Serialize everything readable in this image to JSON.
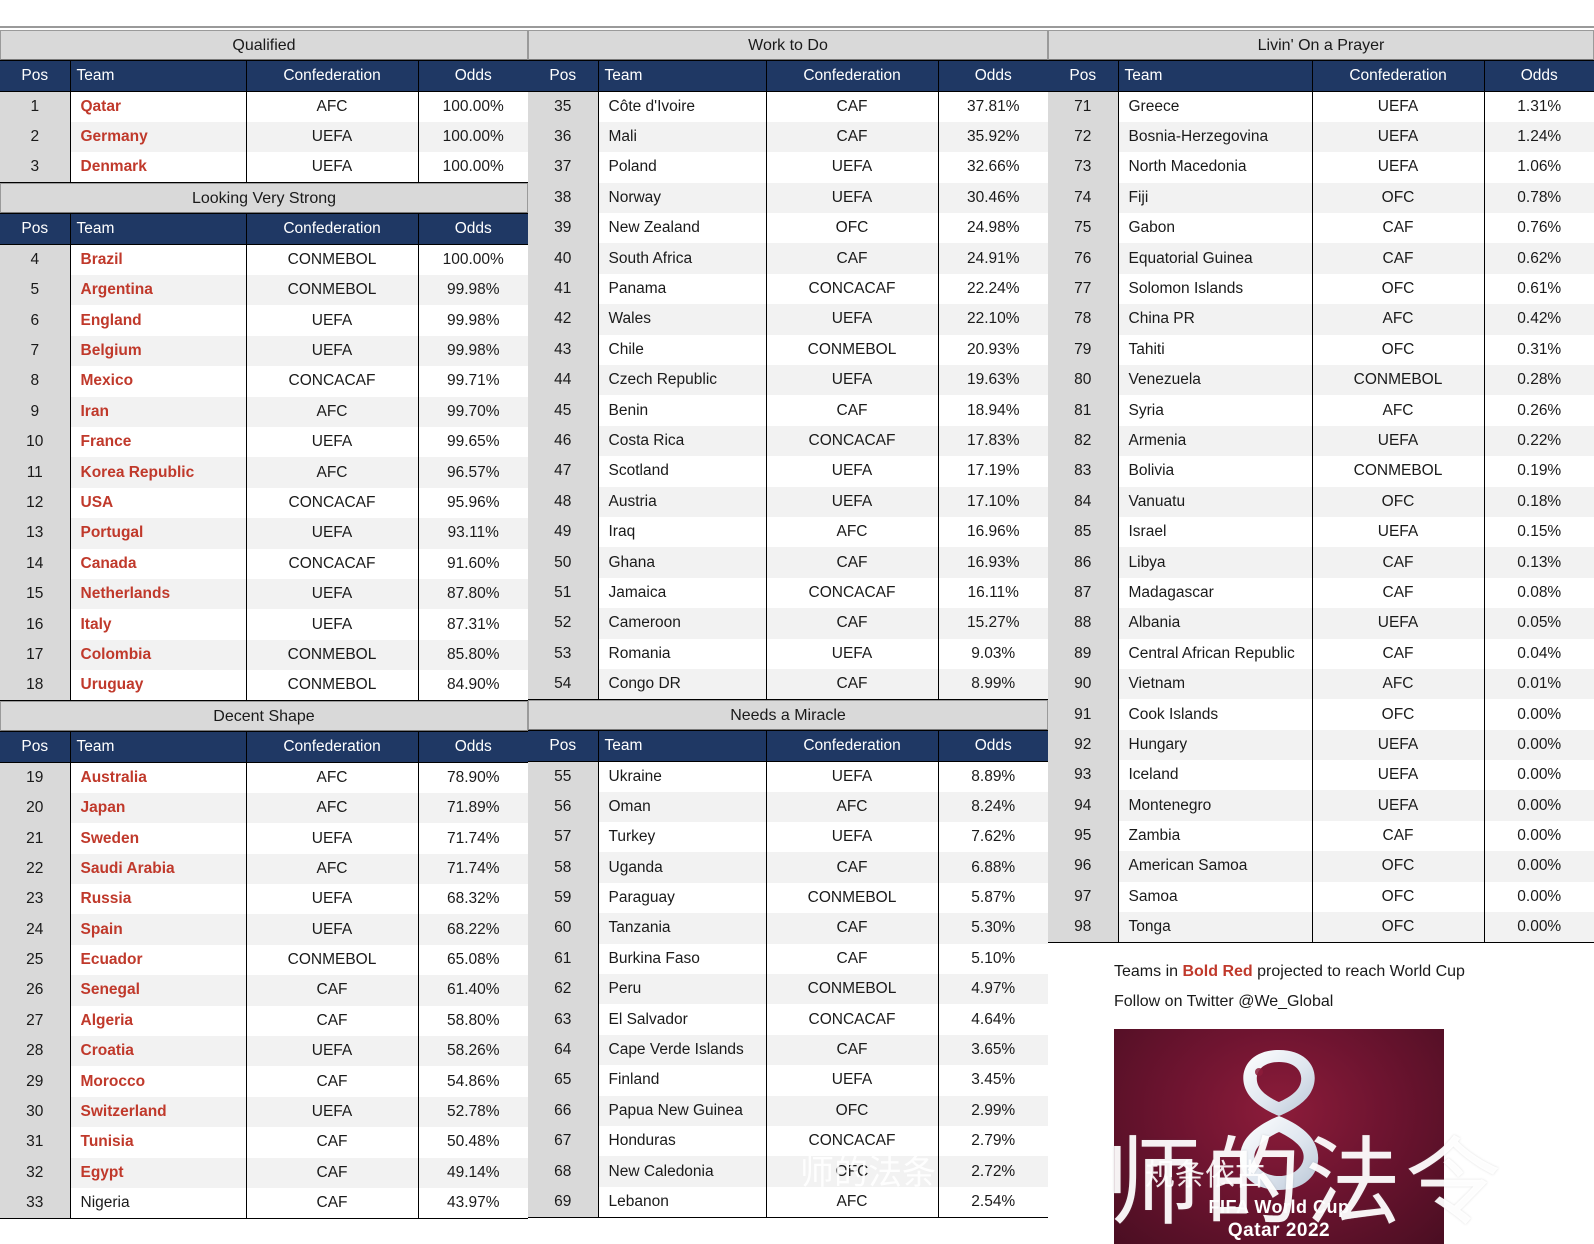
{
  "columns_header": {
    "pos": "Pos",
    "team": "Team",
    "confederation": "Confederation",
    "odds": "Odds"
  },
  "sections": [
    {
      "title": "Qualified",
      "column": "left",
      "rows": [
        {
          "pos": "1",
          "team": "Qatar",
          "conf": "AFC",
          "odds": "100.00%",
          "qualified": true
        },
        {
          "pos": "2",
          "team": "Germany",
          "conf": "UEFA",
          "odds": "100.00%",
          "qualified": true
        },
        {
          "pos": "3",
          "team": "Denmark",
          "conf": "UEFA",
          "odds": "100.00%",
          "qualified": true
        }
      ]
    },
    {
      "title": "Looking Very Strong",
      "column": "left",
      "rows": [
        {
          "pos": "4",
          "team": "Brazil",
          "conf": "CONMEBOL",
          "odds": "100.00%",
          "qualified": true
        },
        {
          "pos": "5",
          "team": "Argentina",
          "conf": "CONMEBOL",
          "odds": "99.98%",
          "qualified": true
        },
        {
          "pos": "6",
          "team": "England",
          "conf": "UEFA",
          "odds": "99.98%",
          "qualified": true
        },
        {
          "pos": "7",
          "team": "Belgium",
          "conf": "UEFA",
          "odds": "99.98%",
          "qualified": true
        },
        {
          "pos": "8",
          "team": "Mexico",
          "conf": "CONCACAF",
          "odds": "99.71%",
          "qualified": true
        },
        {
          "pos": "9",
          "team": "Iran",
          "conf": "AFC",
          "odds": "99.70%",
          "qualified": true
        },
        {
          "pos": "10",
          "team": "France",
          "conf": "UEFA",
          "odds": "99.65%",
          "qualified": true
        },
        {
          "pos": "11",
          "team": "Korea Republic",
          "conf": "AFC",
          "odds": "96.57%",
          "qualified": true
        },
        {
          "pos": "12",
          "team": "USA",
          "conf": "CONCACAF",
          "odds": "95.96%",
          "qualified": true
        },
        {
          "pos": "13",
          "team": "Portugal",
          "conf": "UEFA",
          "odds": "93.11%",
          "qualified": true
        },
        {
          "pos": "14",
          "team": "Canada",
          "conf": "CONCACAF",
          "odds": "91.60%",
          "qualified": true
        },
        {
          "pos": "15",
          "team": "Netherlands",
          "conf": "UEFA",
          "odds": "87.80%",
          "qualified": true
        },
        {
          "pos": "16",
          "team": "Italy",
          "conf": "UEFA",
          "odds": "87.31%",
          "qualified": true
        },
        {
          "pos": "17",
          "team": "Colombia",
          "conf": "CONMEBOL",
          "odds": "85.80%",
          "qualified": true
        },
        {
          "pos": "18",
          "team": "Uruguay",
          "conf": "CONMEBOL",
          "odds": "84.90%",
          "qualified": true
        }
      ]
    },
    {
      "title": "Decent Shape",
      "column": "left",
      "rows": [
        {
          "pos": "19",
          "team": "Australia",
          "conf": "AFC",
          "odds": "78.90%",
          "qualified": true
        },
        {
          "pos": "20",
          "team": "Japan",
          "conf": "AFC",
          "odds": "71.89%",
          "qualified": true
        },
        {
          "pos": "21",
          "team": "Sweden",
          "conf": "UEFA",
          "odds": "71.74%",
          "qualified": true
        },
        {
          "pos": "22",
          "team": "Saudi Arabia",
          "conf": "AFC",
          "odds": "71.74%",
          "qualified": true
        },
        {
          "pos": "23",
          "team": "Russia",
          "conf": "UEFA",
          "odds": "68.32%",
          "qualified": true
        },
        {
          "pos": "24",
          "team": "Spain",
          "conf": "UEFA",
          "odds": "68.22%",
          "qualified": true
        },
        {
          "pos": "25",
          "team": "Ecuador",
          "conf": "CONMEBOL",
          "odds": "65.08%",
          "qualified": true
        },
        {
          "pos": "26",
          "team": "Senegal",
          "conf": "CAF",
          "odds": "61.40%",
          "qualified": true
        },
        {
          "pos": "27",
          "team": "Algeria",
          "conf": "CAF",
          "odds": "58.80%",
          "qualified": true
        },
        {
          "pos": "28",
          "team": "Croatia",
          "conf": "UEFA",
          "odds": "58.26%",
          "qualified": true
        },
        {
          "pos": "29",
          "team": "Morocco",
          "conf": "CAF",
          "odds": "54.86%",
          "qualified": true
        },
        {
          "pos": "30",
          "team": "Switzerland",
          "conf": "UEFA",
          "odds": "52.78%",
          "qualified": true
        },
        {
          "pos": "31",
          "team": "Tunisia",
          "conf": "CAF",
          "odds": "50.48%",
          "qualified": true
        },
        {
          "pos": "32",
          "team": "Egypt",
          "conf": "CAF",
          "odds": "49.14%",
          "qualified": true
        },
        {
          "pos": "33",
          "team": "Nigeria",
          "conf": "CAF",
          "odds": "43.97%",
          "qualified": false
        }
      ]
    },
    {
      "title": "Work to Do",
      "column": "mid",
      "rows": [
        {
          "pos": "35",
          "team": "Côte d'Ivoire",
          "conf": "CAF",
          "odds": "37.81%",
          "qualified": false
        },
        {
          "pos": "36",
          "team": "Mali",
          "conf": "CAF",
          "odds": "35.92%",
          "qualified": false
        },
        {
          "pos": "37",
          "team": "Poland",
          "conf": "UEFA",
          "odds": "32.66%",
          "qualified": false
        },
        {
          "pos": "38",
          "team": "Norway",
          "conf": "UEFA",
          "odds": "30.46%",
          "qualified": false
        },
        {
          "pos": "39",
          "team": "New Zealand",
          "conf": "OFC",
          "odds": "24.98%",
          "qualified": false
        },
        {
          "pos": "40",
          "team": "South Africa",
          "conf": "CAF",
          "odds": "24.91%",
          "qualified": false
        },
        {
          "pos": "41",
          "team": "Panama",
          "conf": "CONCACAF",
          "odds": "22.24%",
          "qualified": false
        },
        {
          "pos": "42",
          "team": "Wales",
          "conf": "UEFA",
          "odds": "22.10%",
          "qualified": false
        },
        {
          "pos": "43",
          "team": "Chile",
          "conf": "CONMEBOL",
          "odds": "20.93%",
          "qualified": false
        },
        {
          "pos": "44",
          "team": "Czech Republic",
          "conf": "UEFA",
          "odds": "19.63%",
          "qualified": false
        },
        {
          "pos": "45",
          "team": "Benin",
          "conf": "CAF",
          "odds": "18.94%",
          "qualified": false
        },
        {
          "pos": "46",
          "team": "Costa Rica",
          "conf": "CONCACAF",
          "odds": "17.83%",
          "qualified": false
        },
        {
          "pos": "47",
          "team": "Scotland",
          "conf": "UEFA",
          "odds": "17.19%",
          "qualified": false
        },
        {
          "pos": "48",
          "team": "Austria",
          "conf": "UEFA",
          "odds": "17.10%",
          "qualified": false
        },
        {
          "pos": "49",
          "team": "Iraq",
          "conf": "AFC",
          "odds": "16.96%",
          "qualified": false
        },
        {
          "pos": "50",
          "team": "Ghana",
          "conf": "CAF",
          "odds": "16.93%",
          "qualified": false
        },
        {
          "pos": "51",
          "team": "Jamaica",
          "conf": "CONCACAF",
          "odds": "16.11%",
          "qualified": false
        },
        {
          "pos": "52",
          "team": "Cameroon",
          "conf": "CAF",
          "odds": "15.27%",
          "qualified": false
        },
        {
          "pos": "53",
          "team": "Romania",
          "conf": "UEFA",
          "odds": "9.03%",
          "qualified": false
        },
        {
          "pos": "54",
          "team": "Congo DR",
          "conf": "CAF",
          "odds": "8.99%",
          "qualified": false
        }
      ]
    },
    {
      "title": "Needs a Miracle",
      "column": "mid",
      "rows": [
        {
          "pos": "55",
          "team": "Ukraine",
          "conf": "UEFA",
          "odds": "8.89%",
          "qualified": false
        },
        {
          "pos": "56",
          "team": "Oman",
          "conf": "AFC",
          "odds": "8.24%",
          "qualified": false
        },
        {
          "pos": "57",
          "team": "Turkey",
          "conf": "UEFA",
          "odds": "7.62%",
          "qualified": false
        },
        {
          "pos": "58",
          "team": "Uganda",
          "conf": "CAF",
          "odds": "6.88%",
          "qualified": false
        },
        {
          "pos": "59",
          "team": "Paraguay",
          "conf": "CONMEBOL",
          "odds": "5.87%",
          "qualified": false
        },
        {
          "pos": "60",
          "team": "Tanzania",
          "conf": "CAF",
          "odds": "5.30%",
          "qualified": false
        },
        {
          "pos": "61",
          "team": "Burkina Faso",
          "conf": "CAF",
          "odds": "5.10%",
          "qualified": false
        },
        {
          "pos": "62",
          "team": "Peru",
          "conf": "CONMEBOL",
          "odds": "4.97%",
          "qualified": false
        },
        {
          "pos": "63",
          "team": "El Salvador",
          "conf": "CONCACAF",
          "odds": "4.64%",
          "qualified": false
        },
        {
          "pos": "64",
          "team": "Cape Verde Islands",
          "conf": "CAF",
          "odds": "3.65%",
          "qualified": false
        },
        {
          "pos": "65",
          "team": "Finland",
          "conf": "UEFA",
          "odds": "3.45%",
          "qualified": false
        },
        {
          "pos": "66",
          "team": "Papua New Guinea",
          "conf": "OFC",
          "odds": "2.99%",
          "qualified": false
        },
        {
          "pos": "67",
          "team": "Honduras",
          "conf": "CONCACAF",
          "odds": "2.79%",
          "qualified": false
        },
        {
          "pos": "68",
          "team": "New Caledonia",
          "conf": "OFC",
          "odds": "2.72%",
          "qualified": false
        },
        {
          "pos": "69",
          "team": "Lebanon",
          "conf": "AFC",
          "odds": "2.54%",
          "qualified": false
        }
      ]
    },
    {
      "title": "Livin' On a Prayer",
      "column": "right",
      "rows": [
        {
          "pos": "71",
          "team": "Greece",
          "conf": "UEFA",
          "odds": "1.31%",
          "qualified": false
        },
        {
          "pos": "72",
          "team": "Bosnia-Herzegovina",
          "conf": "UEFA",
          "odds": "1.24%",
          "qualified": false
        },
        {
          "pos": "73",
          "team": "North Macedonia",
          "conf": "UEFA",
          "odds": "1.06%",
          "qualified": false
        },
        {
          "pos": "74",
          "team": "Fiji",
          "conf": "OFC",
          "odds": "0.78%",
          "qualified": false
        },
        {
          "pos": "75",
          "team": "Gabon",
          "conf": "CAF",
          "odds": "0.76%",
          "qualified": false
        },
        {
          "pos": "76",
          "team": "Equatorial Guinea",
          "conf": "CAF",
          "odds": "0.62%",
          "qualified": false
        },
        {
          "pos": "77",
          "team": "Solomon Islands",
          "conf": "OFC",
          "odds": "0.61%",
          "qualified": false
        },
        {
          "pos": "78",
          "team": "China PR",
          "conf": "AFC",
          "odds": "0.42%",
          "qualified": false
        },
        {
          "pos": "79",
          "team": "Tahiti",
          "conf": "OFC",
          "odds": "0.31%",
          "qualified": false
        },
        {
          "pos": "80",
          "team": "Venezuela",
          "conf": "CONMEBOL",
          "odds": "0.28%",
          "qualified": false
        },
        {
          "pos": "81",
          "team": "Syria",
          "conf": "AFC",
          "odds": "0.26%",
          "qualified": false
        },
        {
          "pos": "82",
          "team": "Armenia",
          "conf": "UEFA",
          "odds": "0.22%",
          "qualified": false
        },
        {
          "pos": "83",
          "team": "Bolivia",
          "conf": "CONMEBOL",
          "odds": "0.19%",
          "qualified": false
        },
        {
          "pos": "84",
          "team": "Vanuatu",
          "conf": "OFC",
          "odds": "0.18%",
          "qualified": false
        },
        {
          "pos": "85",
          "team": "Israel",
          "conf": "UEFA",
          "odds": "0.15%",
          "qualified": false
        },
        {
          "pos": "86",
          "team": "Libya",
          "conf": "CAF",
          "odds": "0.13%",
          "qualified": false
        },
        {
          "pos": "87",
          "team": "Madagascar",
          "conf": "CAF",
          "odds": "0.08%",
          "qualified": false
        },
        {
          "pos": "88",
          "team": "Albania",
          "conf": "UEFA",
          "odds": "0.05%",
          "qualified": false
        },
        {
          "pos": "89",
          "team": "Central African Republic",
          "conf": "CAF",
          "odds": "0.04%",
          "qualified": false
        },
        {
          "pos": "90",
          "team": "Vietnam",
          "conf": "AFC",
          "odds": "0.01%",
          "qualified": false
        },
        {
          "pos": "91",
          "team": "Cook Islands",
          "conf": "OFC",
          "odds": "0.00%",
          "qualified": false
        },
        {
          "pos": "92",
          "team": "Hungary",
          "conf": "UEFA",
          "odds": "0.00%",
          "qualified": false
        },
        {
          "pos": "93",
          "team": "Iceland",
          "conf": "UEFA",
          "odds": "0.00%",
          "qualified": false
        },
        {
          "pos": "94",
          "team": "Montenegro",
          "conf": "UEFA",
          "odds": "0.00%",
          "qualified": false
        },
        {
          "pos": "95",
          "team": "Zambia",
          "conf": "CAF",
          "odds": "0.00%",
          "qualified": false
        },
        {
          "pos": "96",
          "team": "American Samoa",
          "conf": "OFC",
          "odds": "0.00%",
          "qualified": false
        },
        {
          "pos": "97",
          "team": "Samoa",
          "conf": "OFC",
          "odds": "0.00%",
          "qualified": false
        },
        {
          "pos": "98",
          "team": "Tonga",
          "conf": "OFC",
          "odds": "0.00%",
          "qualified": false
        }
      ]
    }
  ],
  "footer": {
    "legend_pre": "Teams in ",
    "legend_em": "Bold Red",
    "legend_post": " projected to reach World Cup",
    "twitter": "Follow on Twitter @We_Global"
  },
  "logo": {
    "line1": "FIFA World Cup",
    "line2": "Qatar 2022"
  },
  "watermarks": {
    "big": "师的法令",
    "mid": "规条依古",
    "faint": "师的法条"
  },
  "colors": {
    "header_navy": "#1F3864",
    "odds_maroon": "#7B2E26",
    "band_gray": "#D9D9D9",
    "qualified_red": "#C0392B",
    "stripe": "#F2F2F2"
  }
}
